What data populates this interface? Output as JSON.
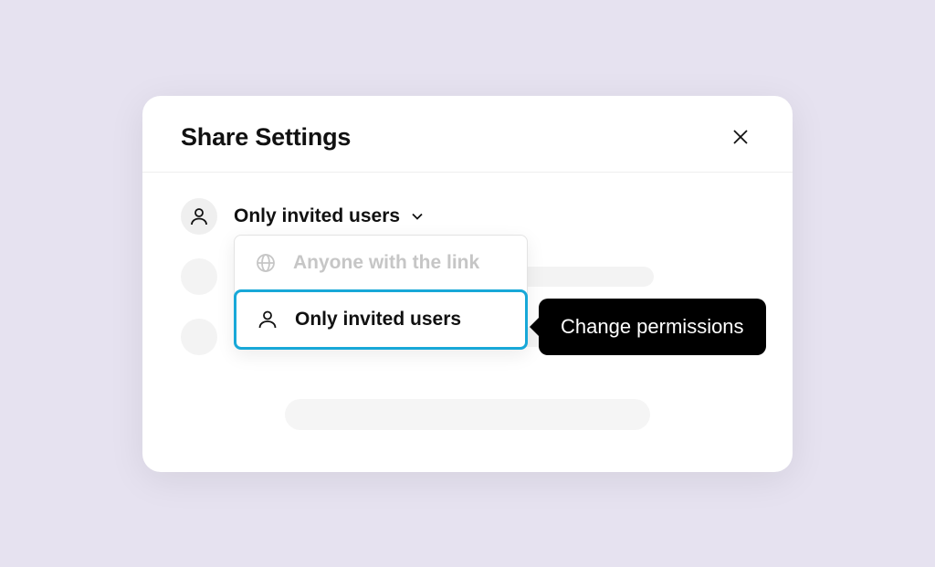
{
  "modal": {
    "title": "Share Settings"
  },
  "selector": {
    "current": "Only invited users"
  },
  "dropdown": {
    "option_anyone": "Anyone with the link",
    "option_invited": "Only invited users"
  },
  "tooltip": {
    "text": "Change permissions"
  },
  "colors": {
    "bg": "#e6e2f0",
    "accent": "#18a8d8"
  }
}
